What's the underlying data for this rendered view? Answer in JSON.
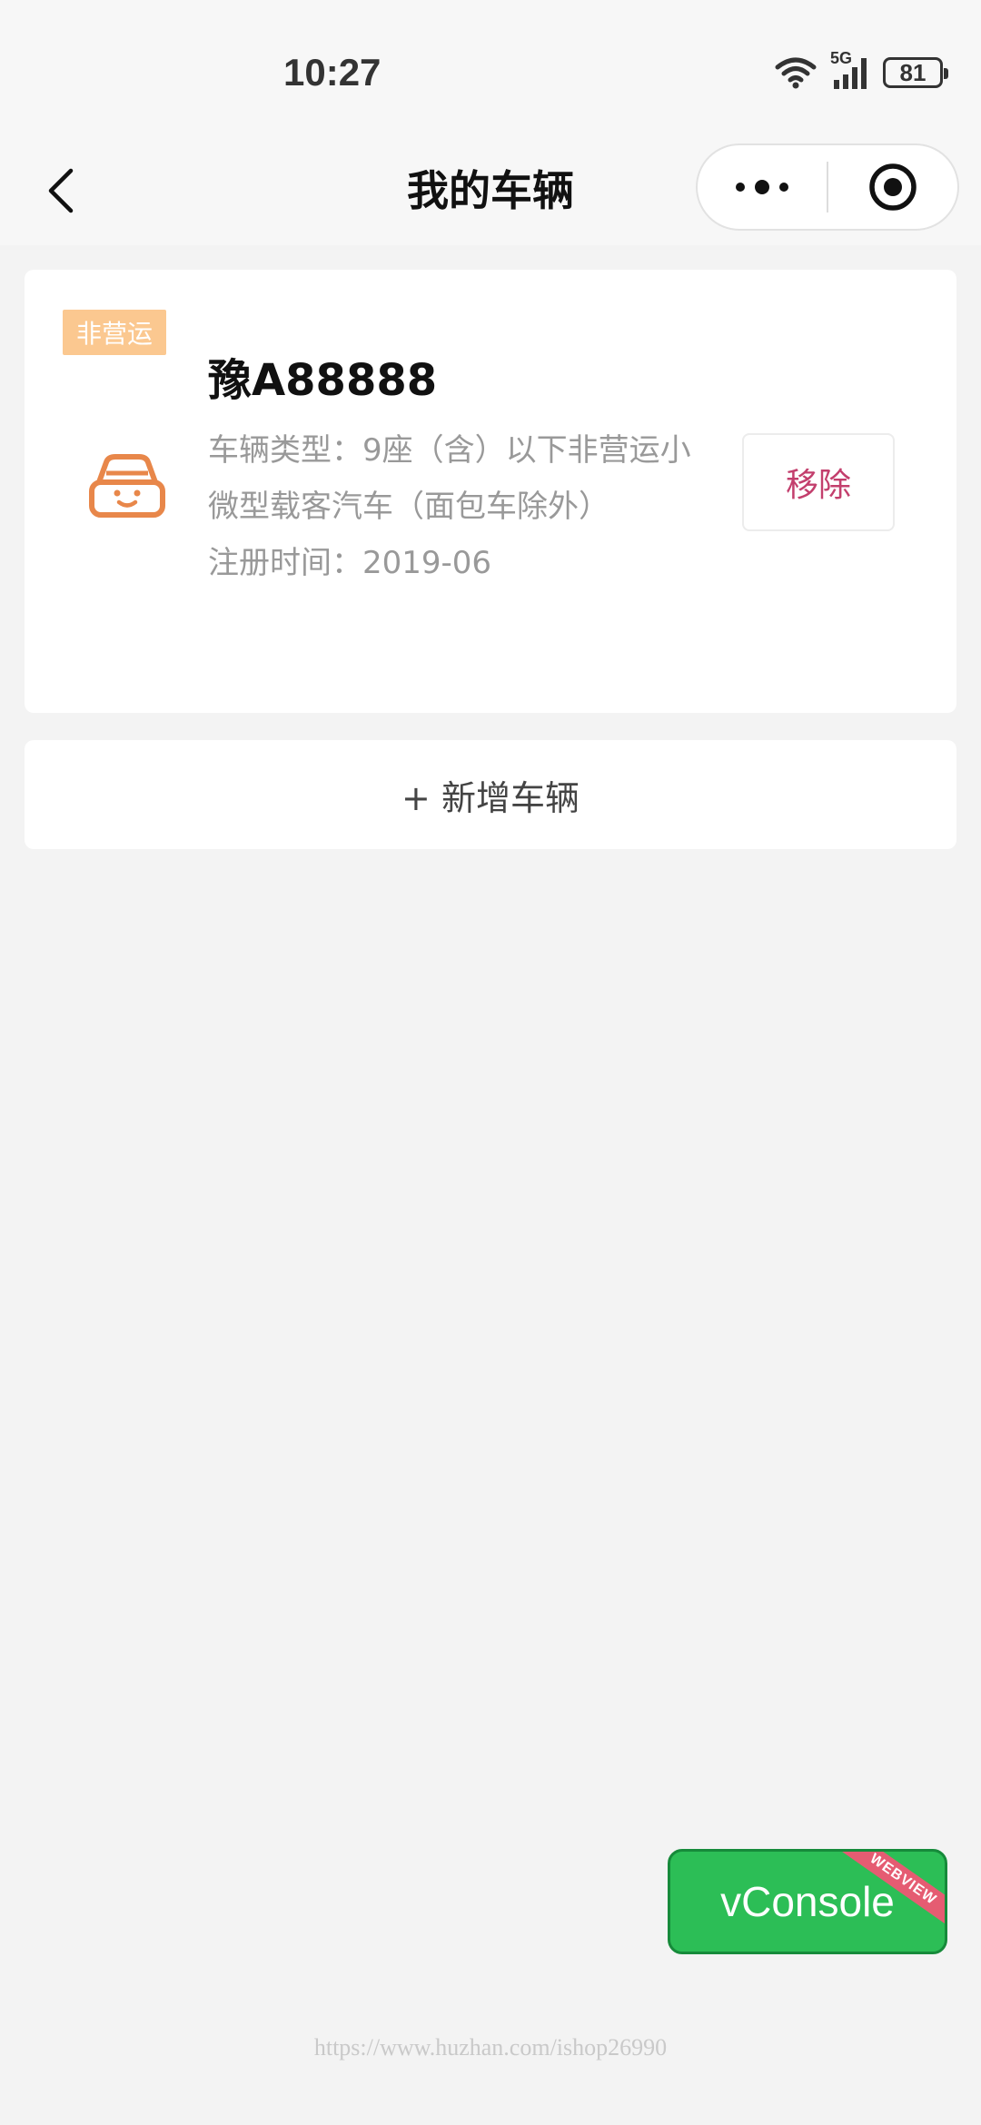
{
  "status_bar": {
    "time": "10:27",
    "network": "5G",
    "battery": "81"
  },
  "navbar": {
    "title": "我的车辆"
  },
  "vehicle": {
    "tag": "非营运",
    "plate": "豫A88888",
    "type_line": "车辆类型：9座（含）以下非营运小微型载客汽车（面包车除外）",
    "reg_line": "注册时间：2019-06",
    "remove_label": "移除"
  },
  "add_vehicle_label": "+ 新增车辆",
  "vconsole": {
    "label": "vConsole",
    "ribbon": "WEBVIEW"
  },
  "watermark": "https://www.huzhan.com/ishop26990",
  "colors": {
    "tag_bg": "#fbc890",
    "icon": "#e8874a",
    "remove_text": "#c33f6d",
    "vconsole_bg": "#2cbe56"
  }
}
